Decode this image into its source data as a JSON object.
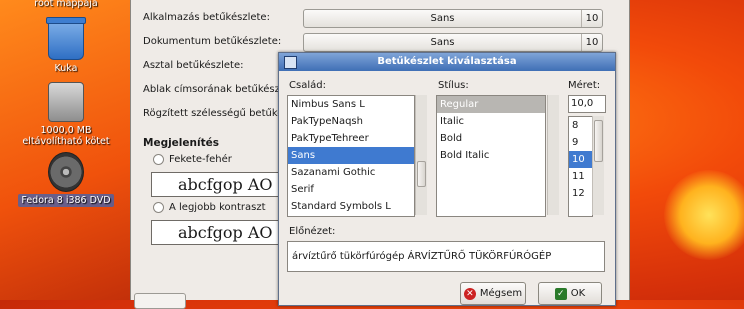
{
  "desktop": {
    "icons": [
      {
        "label": "root mappája",
        "icon": "home-folder-icon"
      },
      {
        "label": "Kuka",
        "icon": "trash-icon"
      },
      {
        "label_line1": "1000,0 MB",
        "label_line2": "eltávolítható kötet",
        "icon": "removable-disk-icon"
      },
      {
        "label": "Fedora 8 i386 DVD",
        "icon": "dvd-icon"
      }
    ]
  },
  "font_preferences": {
    "rows": [
      {
        "label": "Alkalmazás betűkészlete:",
        "font": "Sans",
        "size": "10"
      },
      {
        "label": "Dokumentum betűkészlete:",
        "font": "Sans",
        "size": "10"
      },
      {
        "label": "Asztal betűkészlete:"
      },
      {
        "label": "Ablak címsorának betűkészlete:"
      },
      {
        "label": "Rögzített szélességű betűkészlet:"
      }
    ],
    "rendering_title": "Megjelenítés",
    "options": [
      {
        "label": "Fekete-fehér",
        "sample": "abcfgop AO a"
      },
      {
        "label": "A legjobb kontraszt",
        "sample": "abcfgop AO a"
      }
    ]
  },
  "font_chooser": {
    "title": "Betűkészlet kiválasztása",
    "family_label": "Család:",
    "style_label": "Stílus:",
    "size_label": "Méret:",
    "families": [
      "Nimbus Sans L",
      "PakTypeNaqsh",
      "PakTypeTehreer",
      "Sans",
      "Sazanami Gothic",
      "Serif",
      "Standard Symbols L"
    ],
    "selected_family": "Sans",
    "styles": [
      "Regular",
      "Italic",
      "Bold",
      "Bold Italic"
    ],
    "selected_style": "Regular",
    "size_value": "10,0",
    "sizes": [
      "8",
      "9",
      "10",
      "11",
      "12"
    ],
    "selected_size": "10",
    "preview_label": "Előnézet:",
    "preview_text": "árvíztűrő tükörfúrógép ÁRVÍZTŰRŐ TÜKÖRFÚRÓGÉP",
    "cancel_label": "Mégsem",
    "ok_label": "OK",
    "colors": {
      "selection": "#3f7ad0",
      "titlebar": "#3f6fb5"
    }
  }
}
